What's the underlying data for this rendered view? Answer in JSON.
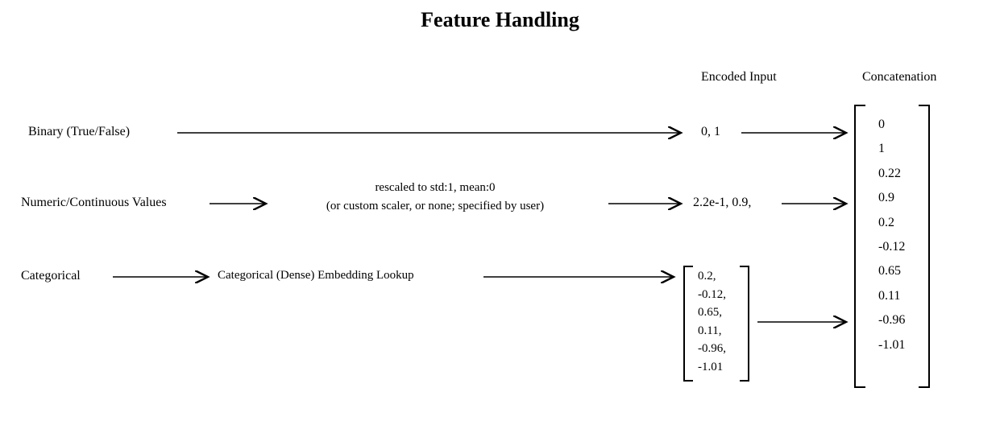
{
  "title": "Feature Handling",
  "headers": {
    "encoded": "Encoded Input",
    "concat": "Concatenation"
  },
  "rows": {
    "binary": {
      "label": "Binary (True/False)",
      "encoded": "0, 1"
    },
    "numeric": {
      "label": "Numeric/Continuous Values",
      "transform_line1": "rescaled to std:1, mean:0",
      "transform_line2": "(or custom scaler, or none; specified by user)",
      "encoded": "2.2e-1, 0.9,"
    },
    "categorical": {
      "label": "Categorical",
      "transform": "Categorical (Dense) Embedding Lookup",
      "vec": [
        "0.2,",
        "-0.12,",
        "0.65,",
        "0.11,",
        "-0.96,",
        "-1.01"
      ]
    }
  },
  "concat": [
    "0",
    "1",
    "0.22",
    "0.9",
    "0.2",
    "-0.12",
    "0.65",
    "0.11",
    "-0.96",
    "-1.01"
  ]
}
